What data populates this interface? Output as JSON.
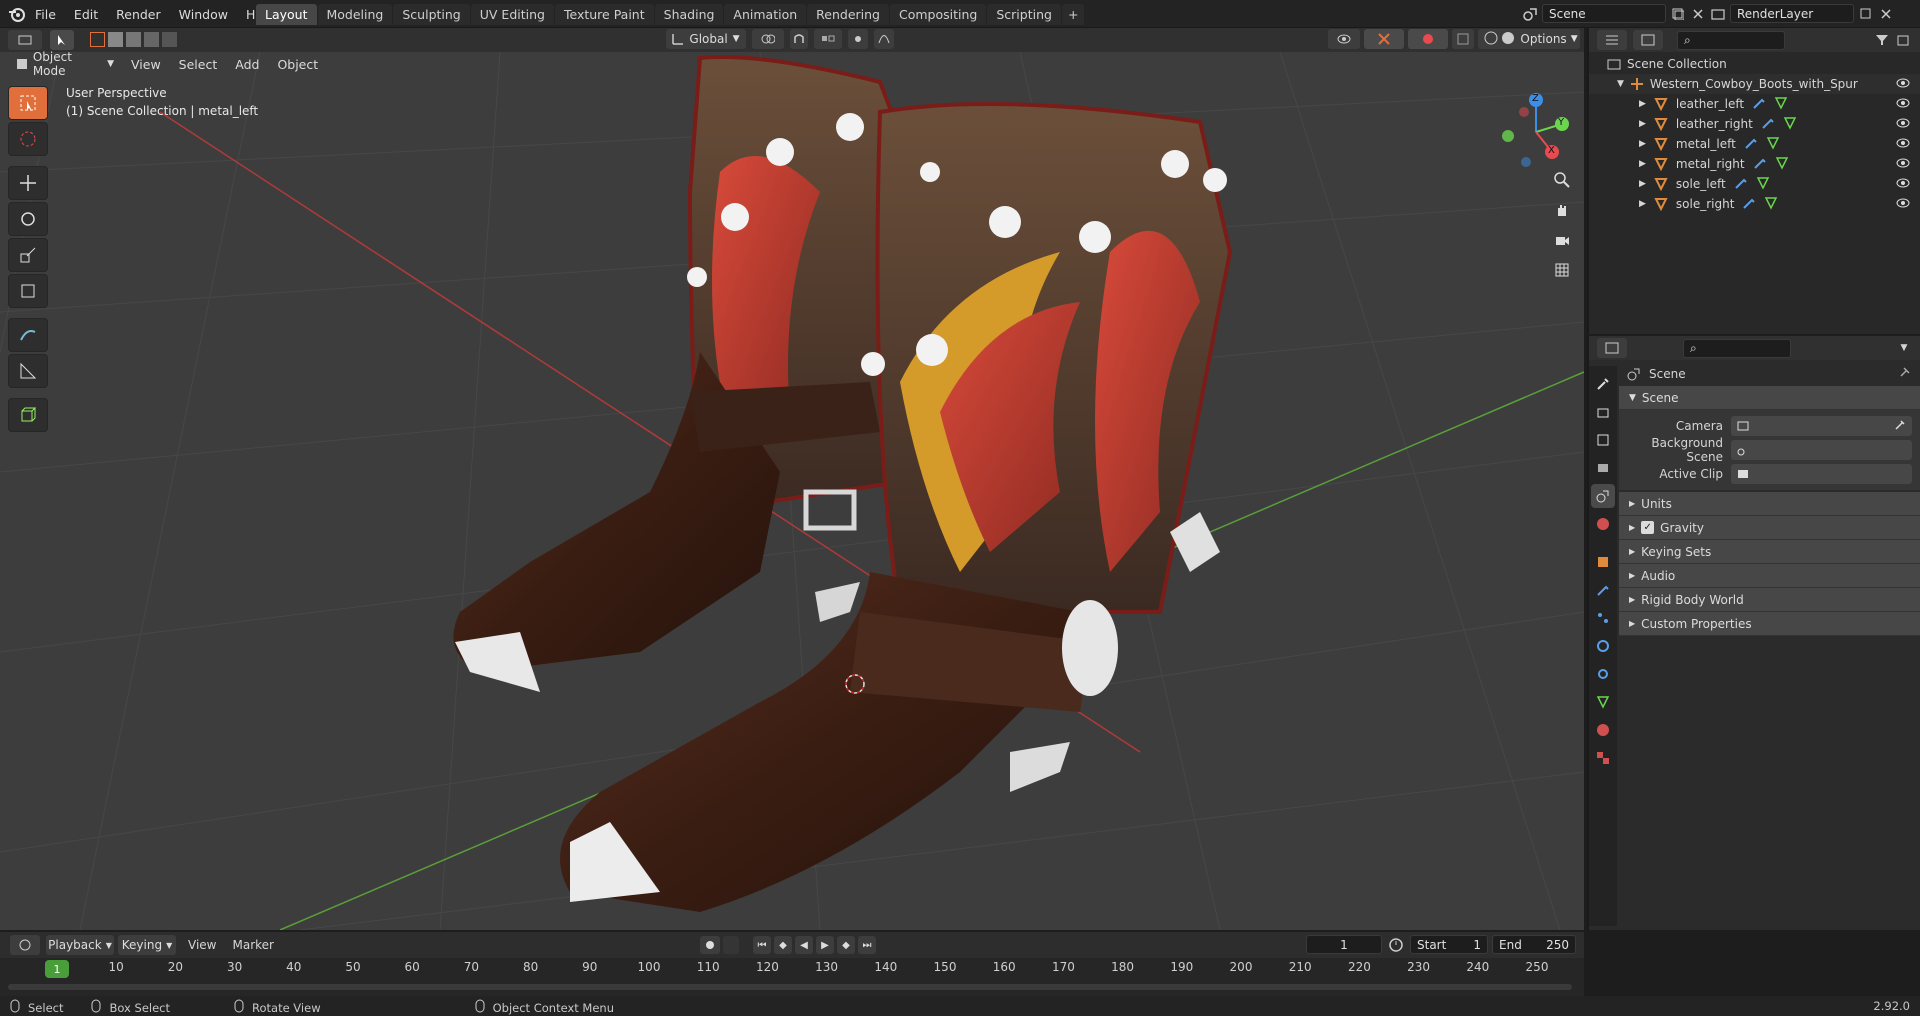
{
  "topbar": {
    "menus": [
      "File",
      "Edit",
      "Render",
      "Window",
      "Help"
    ],
    "workspaces": [
      "Layout",
      "Modeling",
      "Sculpting",
      "UV Editing",
      "Texture Paint",
      "Shading",
      "Animation",
      "Rendering",
      "Compositing",
      "Scripting"
    ],
    "active_workspace": "Layout",
    "add_tab": "+",
    "scene_name": "Scene",
    "view_layer": "RenderLayer"
  },
  "viewport_header": {
    "mode": "Object Mode",
    "menus": [
      "View",
      "Select",
      "Add",
      "Object"
    ],
    "transform_orientation": "Global",
    "options_label": "Options"
  },
  "viewport": {
    "perspective_label": "User Perspective",
    "collection_label": "(1) Scene Collection | metal_left",
    "gizmo_axes": {
      "x": "X",
      "y": "Y",
      "z": "Z"
    }
  },
  "outliner": {
    "root": "Scene Collection",
    "collection": "Western_Cowboy_Boots_with_Spur",
    "objects": [
      "leather_left",
      "leather_right",
      "metal_left",
      "metal_right",
      "sole_left",
      "sole_right"
    ]
  },
  "properties": {
    "header": "Scene",
    "panel": "Scene",
    "fields": [
      {
        "label": "Camera",
        "value": ""
      },
      {
        "label": "Background Scene",
        "value": ""
      },
      {
        "label": "Active Clip",
        "value": ""
      }
    ],
    "subpanels": [
      "Units",
      "Gravity",
      "Keying Sets",
      "Audio",
      "Rigid Body World",
      "Custom Properties"
    ],
    "gravity_checked": true
  },
  "timeline": {
    "menus": [
      "Playback",
      "Keying",
      "View",
      "Marker"
    ],
    "current_frame": "1",
    "start_label": "Start",
    "start_value": "1",
    "end_label": "End",
    "end_value": "250",
    "ticks": [
      "10",
      "20",
      "30",
      "40",
      "50",
      "60",
      "70",
      "80",
      "90",
      "100",
      "110",
      "120",
      "130",
      "140",
      "150",
      "160",
      "170",
      "180",
      "190",
      "200",
      "210",
      "220",
      "230",
      "240",
      "250"
    ],
    "playhead": "1"
  },
  "statusbar": {
    "select": "Select",
    "box_select": "Box Select",
    "rotate_view": "Rotate View",
    "context_menu": "Object Context Menu",
    "version": "2.92.0"
  },
  "colors": {
    "accent": "#e06f3b",
    "x_axis": "#e84a4f",
    "y_axis": "#6bd64d",
    "z_axis": "#3b8fe8"
  }
}
